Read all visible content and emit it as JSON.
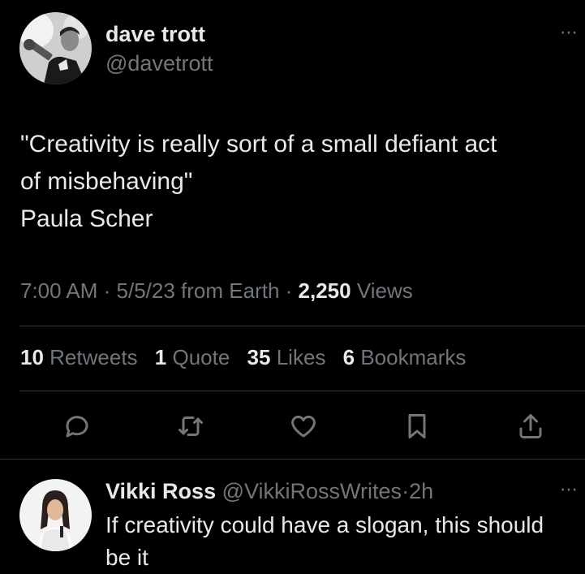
{
  "tweet": {
    "author_name": "dave trott",
    "author_handle": "@davetrott",
    "more_icon": "⋯",
    "text_lines": [
      "\"Creativity is really sort of a small defiant act",
      "of misbehaving\"",
      "Paula Scher"
    ],
    "time": "7:00 AM",
    "date": "5/5/23",
    "source": "from Earth",
    "views_count": "2,250",
    "views_label": "Views",
    "separator": " · "
  },
  "stats": {
    "retweets_count": "10",
    "retweets_label": "Retweets",
    "quotes_count": "1",
    "quotes_label": "Quote",
    "likes_count": "35",
    "likes_label": "Likes",
    "bookmarks_count": "6",
    "bookmarks_label": "Bookmarks"
  },
  "actions": [
    "reply-icon",
    "retweet-icon",
    "like-icon",
    "bookmark-icon",
    "share-icon"
  ],
  "reply": {
    "author_name": "Vikki Ross",
    "author_handle": "@VikkiRossWrites",
    "time": "2h",
    "separator": "·",
    "more_icon": "⋯",
    "text_lines": [
      "If creativity could have a slogan, this should",
      "be it"
    ]
  },
  "colors": {
    "background": "#000000",
    "text": "#e7e9ea",
    "muted": "#71767b",
    "divider": "#2f3336"
  }
}
